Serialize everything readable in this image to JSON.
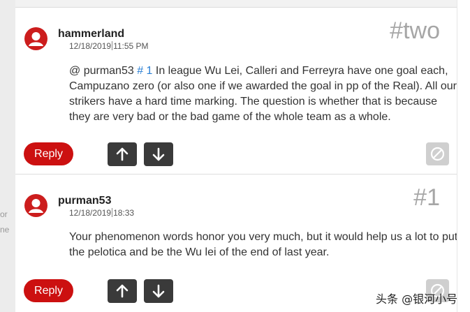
{
  "edge": {
    "fragment_a": "or",
    "fragment_b": "ne"
  },
  "comments": [
    {
      "username": "hammerland",
      "date": "12/18/2019",
      "time": "11:55 PM",
      "number": "#two",
      "mention": "@ purman53",
      "ref": "# 1",
      "text": " In league Wu Lei, Calleri and Ferreyra have one goal each, Campuzano zero (or also one if we awarded the goal in pp of the Real). All our strikers have a hard time marking. The question is whether that is because they are very bad or the bad game of the whole team as a whole.",
      "reply_label": "Reply"
    },
    {
      "username": "purman53",
      "date": "12/18/2019",
      "time": "18:33",
      "number": "#1",
      "text": "Your phenomenon words honor you very much, but it would help us a lot to put the pelotica and be the Wu lei of the end of last year.",
      "reply_label": "Reply"
    }
  ],
  "icons": {
    "upvote": "arrow-up-icon",
    "downvote": "arrow-down-icon",
    "flag": "flag-disabled-icon",
    "avatar": "user-avatar-icon"
  },
  "colors": {
    "accent": "#cc1010",
    "vote_bg": "#3a3a3a",
    "link": "#2a7fd4",
    "number": "#a6a6a6"
  },
  "watermark": "头条 @银河小号"
}
